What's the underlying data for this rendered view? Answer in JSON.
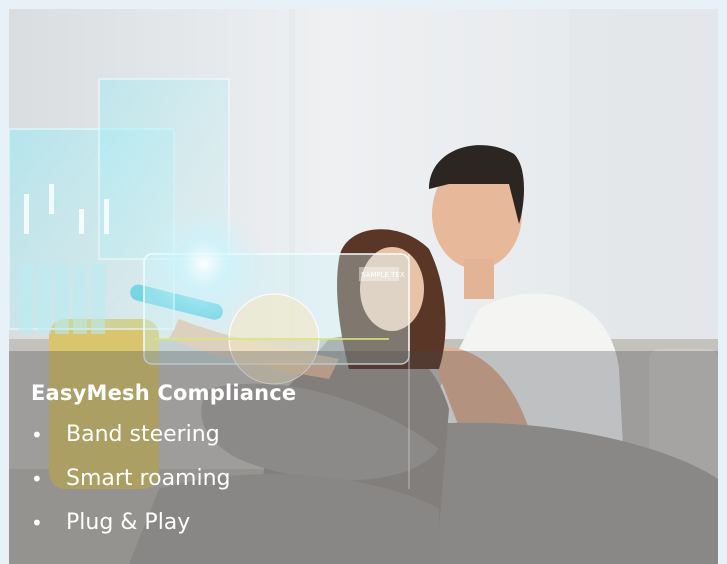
{
  "caption": {
    "title": "EasyMesh Compliance",
    "bullets": [
      "Band steering",
      "Smart roaming",
      "Plug & Play"
    ],
    "bullet_glyph": "•"
  },
  "hologram_text": "SAMPLE TEX",
  "colors": {
    "frame_border": "#e8f1f8",
    "caption_text": "#ffffff",
    "overlay": "#464a50",
    "hologram": "#8fe6f0"
  }
}
